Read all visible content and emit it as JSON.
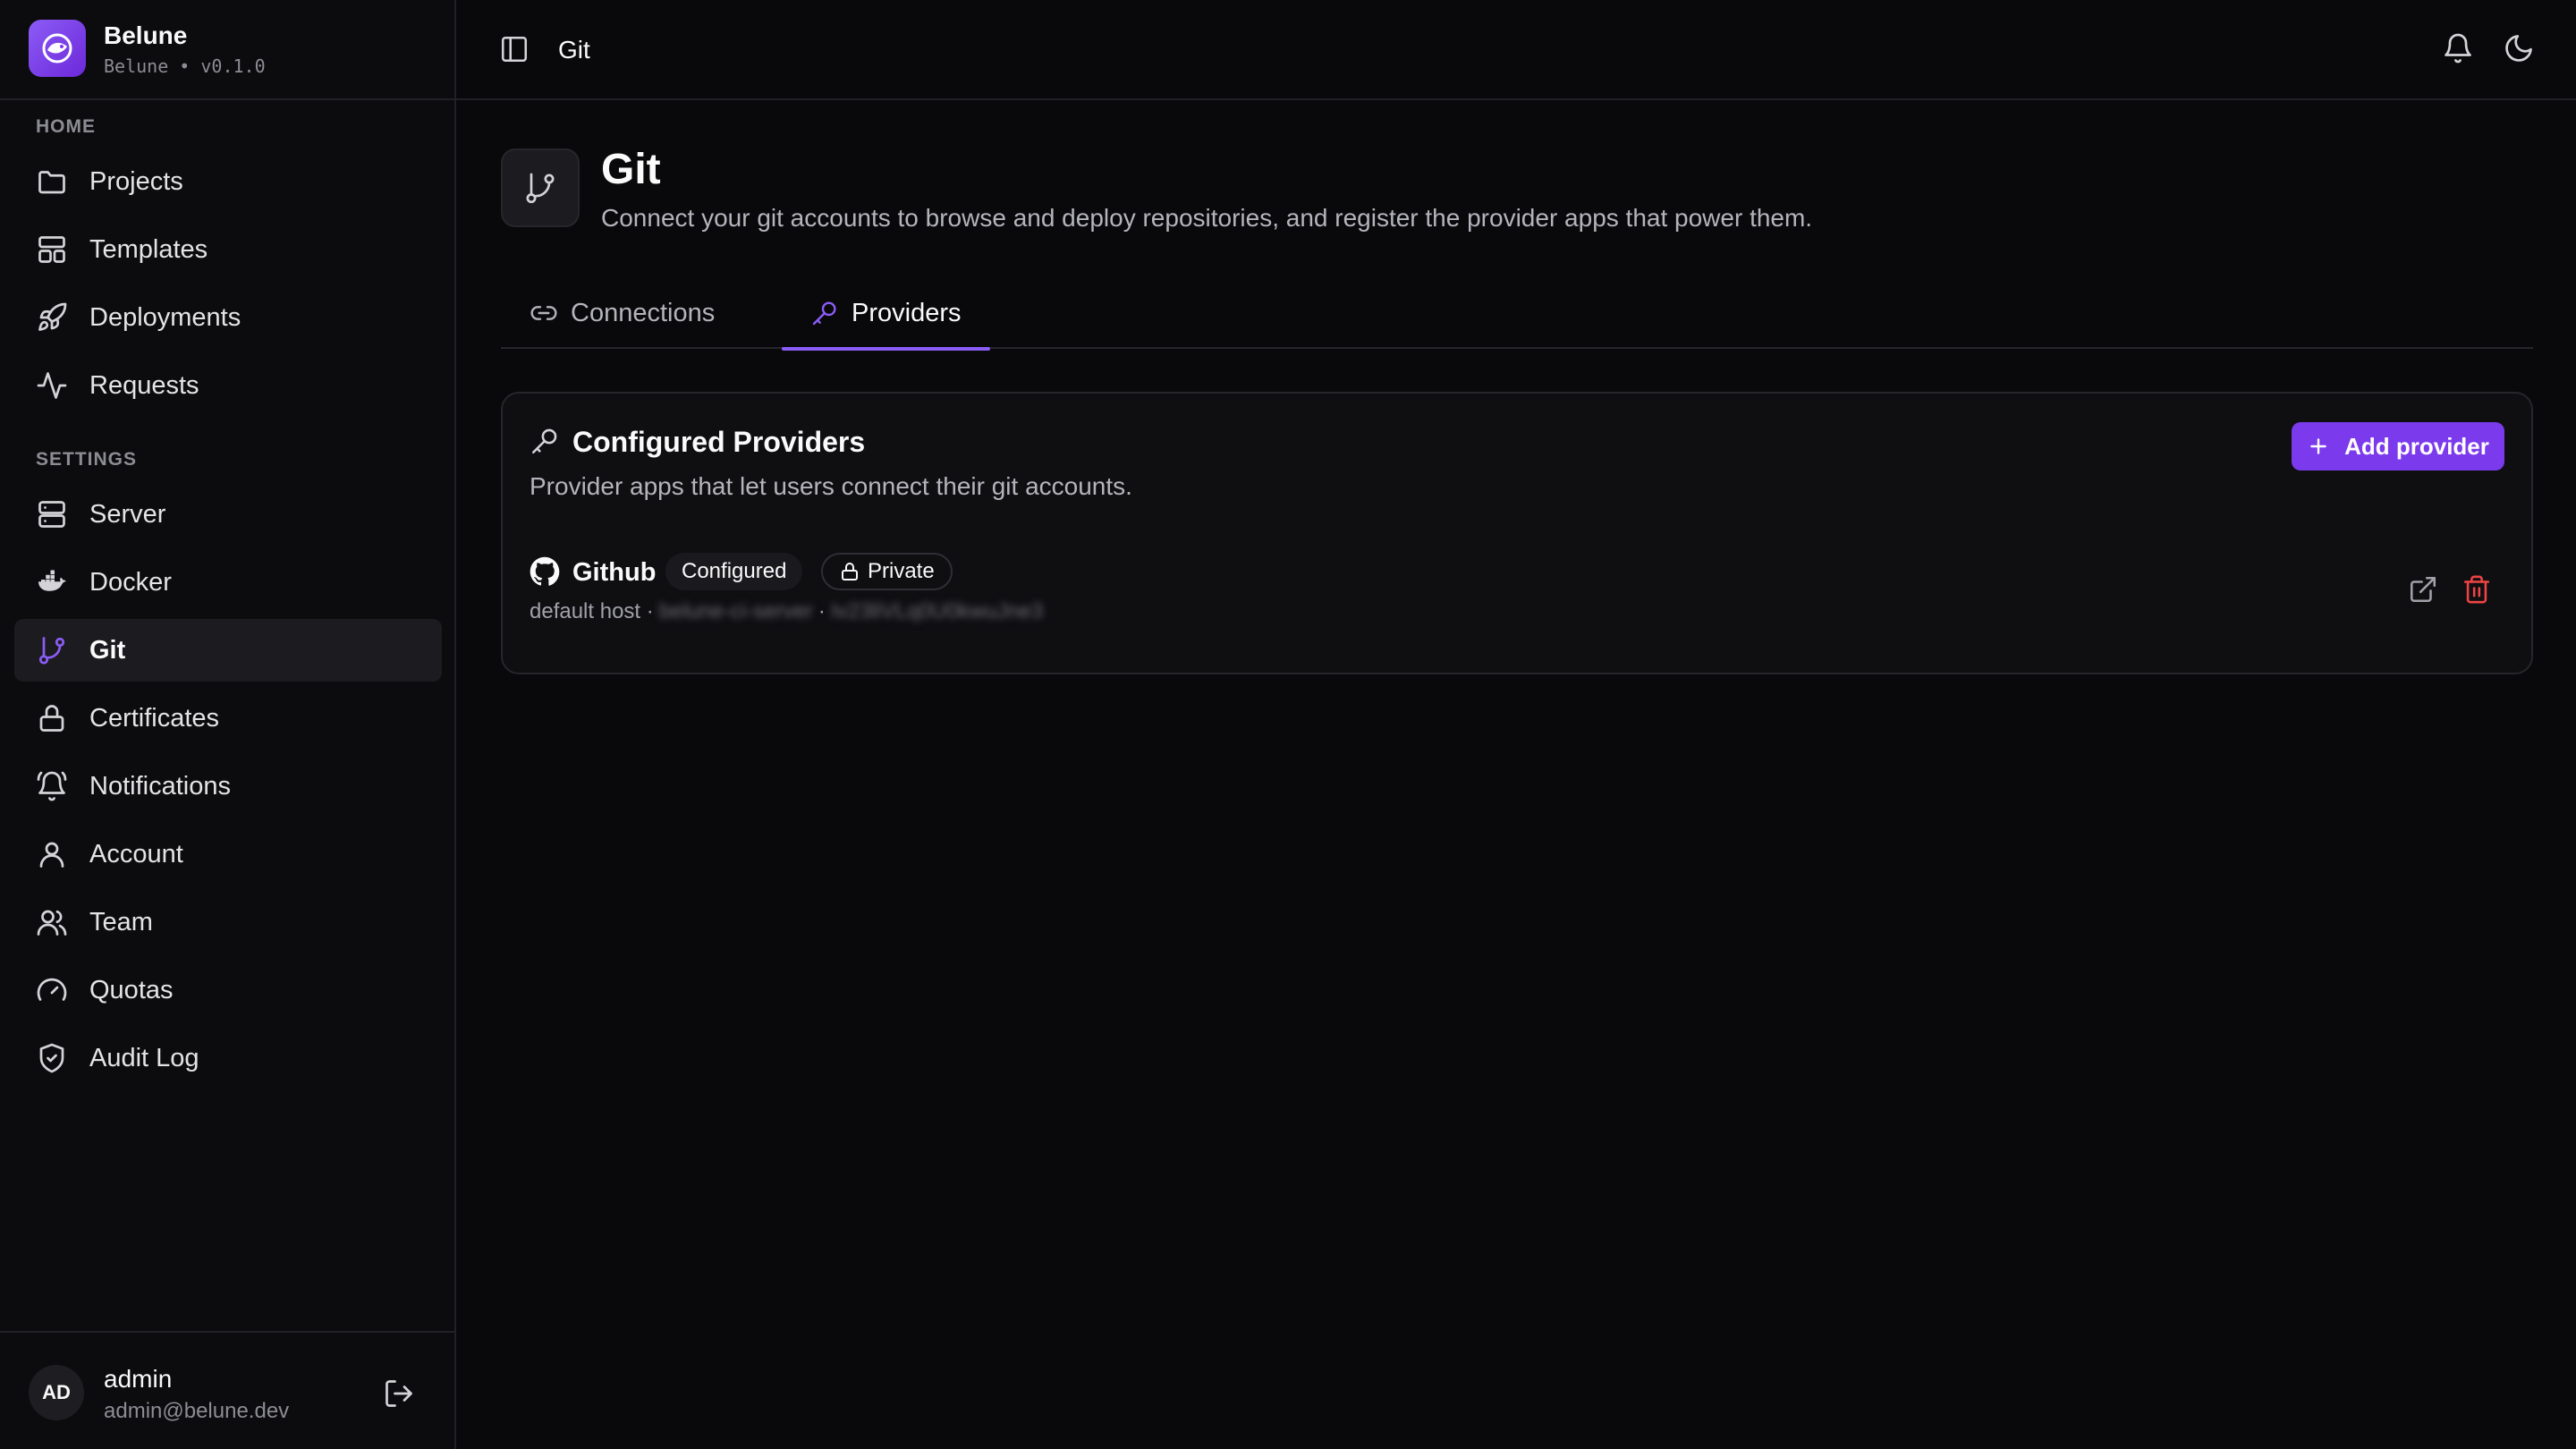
{
  "brand": {
    "name": "Belune",
    "version": "Belune • v0.1.0",
    "accent": "#7c3aed"
  },
  "sidebar": {
    "home_label": "HOME",
    "settings_label": "SETTINGS",
    "home_items": [
      {
        "label": "Projects",
        "icon": "folder-icon"
      },
      {
        "label": "Templates",
        "icon": "layout-icon"
      },
      {
        "label": "Deployments",
        "icon": "rocket-icon"
      },
      {
        "label": "Requests",
        "icon": "activity-icon"
      }
    ],
    "settings_items": [
      {
        "label": "Server",
        "icon": "server-icon"
      },
      {
        "label": "Docker",
        "icon": "docker-icon"
      },
      {
        "label": "Git",
        "icon": "git-branch-icon",
        "active": true
      },
      {
        "label": "Certificates",
        "icon": "lock-icon"
      },
      {
        "label": "Notifications",
        "icon": "bell-ring-icon"
      },
      {
        "label": "Account",
        "icon": "user-icon"
      },
      {
        "label": "Team",
        "icon": "users-icon"
      },
      {
        "label": "Quotas",
        "icon": "gauge-icon"
      },
      {
        "label": "Audit Log",
        "icon": "shield-check-icon"
      }
    ]
  },
  "user": {
    "initials": "AD",
    "name": "admin",
    "email": "admin@belune.dev"
  },
  "topbar": {
    "breadcrumb": "Git"
  },
  "page": {
    "title": "Git",
    "subtitle": "Connect your git accounts to browse and deploy repositories, and register the provider apps that power them."
  },
  "tabs": [
    {
      "label": "Connections",
      "icon": "link-icon",
      "active": false
    },
    {
      "label": "Providers",
      "icon": "key-icon",
      "active": true
    }
  ],
  "card": {
    "title": "Configured Providers",
    "description": "Provider apps that let users connect their git accounts.",
    "add_button": "Add provider"
  },
  "provider": {
    "name": "Github",
    "status_badge": "Configured",
    "visibility_badge": "Private",
    "meta_prefix": "default host ·",
    "meta_host": "belune-ci-server",
    "meta_sep": "·",
    "meta_id": "Iv23liVLq0U0kwuJne3"
  }
}
